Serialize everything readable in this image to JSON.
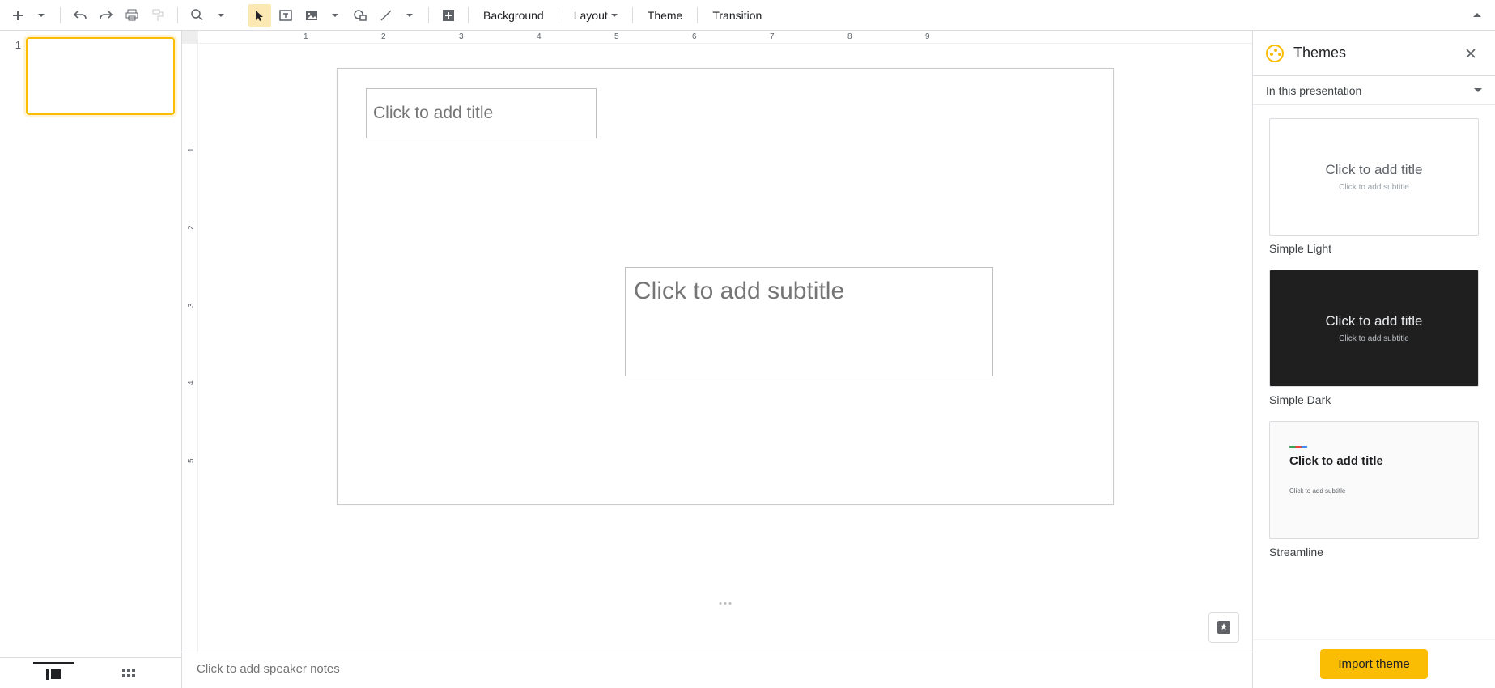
{
  "toolbar": {
    "background_label": "Background",
    "layout_label": "Layout",
    "theme_label": "Theme",
    "transition_label": "Transition"
  },
  "ruler": {
    "h": [
      "1",
      "2",
      "3",
      "4",
      "5",
      "6",
      "7",
      "8",
      "9"
    ],
    "v": [
      "1",
      "2",
      "3",
      "4",
      "5"
    ]
  },
  "filmstrip": {
    "slides": [
      {
        "number": "1"
      }
    ]
  },
  "slide": {
    "title_placeholder": "Click to add title",
    "subtitle_placeholder": "Click to add subtitle"
  },
  "notes": {
    "placeholder": "Click to add speaker notes"
  },
  "themes_panel": {
    "title": "Themes",
    "section_label": "In this presentation",
    "preview_title": "Click to add title",
    "preview_subtitle": "Click to add subtitle",
    "themes": [
      {
        "name": "Simple Light",
        "variant": "light"
      },
      {
        "name": "Simple Dark",
        "variant": "dark"
      },
      {
        "name": "Streamline",
        "variant": "streamline"
      }
    ],
    "import_label": "Import theme"
  }
}
